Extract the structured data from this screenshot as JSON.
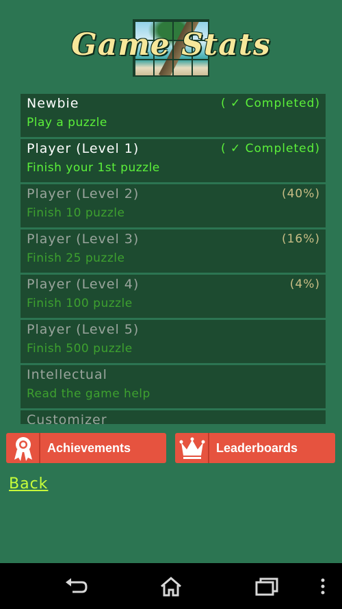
{
  "header": {
    "title": "Game Stats"
  },
  "achievements": [
    {
      "name": "Newbie",
      "description": "Play a puzzle",
      "status": "( ✓ Completed)",
      "completed": true
    },
    {
      "name": "Player (Level 1)",
      "description": "Finish your 1st puzzle",
      "status": "( ✓ Completed)",
      "completed": true
    },
    {
      "name": "Player (Level 2)",
      "description": "Finish 10 puzzle",
      "status": "(40%)",
      "completed": false
    },
    {
      "name": "Player (Level 3)",
      "description": "Finish 25 puzzle",
      "status": "(16%)",
      "completed": false
    },
    {
      "name": "Player (Level 4)",
      "description": "Finish 100 puzzle",
      "status": "(4%)",
      "completed": false
    },
    {
      "name": "Player (Level 5)",
      "description": "Finish 500 puzzle",
      "status": "",
      "completed": false
    },
    {
      "name": "Intellectual",
      "description": "Read the game help",
      "status": "",
      "completed": false
    },
    {
      "name": "Customizer",
      "description": "",
      "status": "",
      "completed": false
    }
  ],
  "buttons": {
    "achievements_label": "Achievements",
    "leaderboards_label": "Leaderboards"
  },
  "back_label": "Back",
  "colors": {
    "background": "#2c7552",
    "row": "#1d4b30",
    "button": "#e6533f",
    "completed": "#5cf03a",
    "title": "#f6e79a",
    "link": "#c8ff3a"
  },
  "icons": {
    "achievements": "ribbon-medal-icon",
    "leaderboards": "crown-icon",
    "nav_back": "back-arrow-icon",
    "nav_home": "home-icon",
    "nav_recents": "recent-apps-icon",
    "nav_menu": "overflow-menu-icon"
  }
}
